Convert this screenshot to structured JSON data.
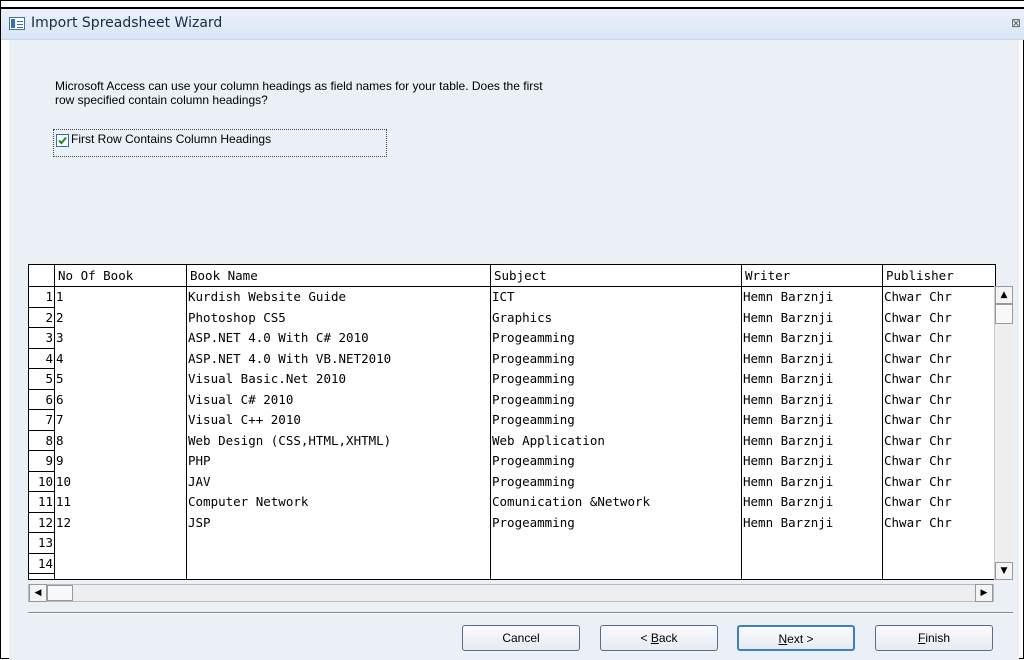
{
  "window": {
    "title": "Import Spreadsheet Wizard",
    "close_glyph": "⊠"
  },
  "instructions": {
    "line1": "Microsoft Access can use your column headings as field names for your table. Does the first",
    "line2": "row specified contain column headings?"
  },
  "checkbox": {
    "label": "First Row Contains Column Headings",
    "checked": true
  },
  "grid": {
    "headers": [
      "No Of Book",
      "Book Name",
      "Subject",
      "Writer",
      "Publisher"
    ],
    "row_numbers": [
      "1",
      "2",
      "3",
      "4",
      "5",
      "6",
      "7",
      "8",
      "9",
      "10",
      "11",
      "12",
      "13",
      "14"
    ],
    "columns": {
      "no": [
        "1",
        "2",
        "3",
        "4",
        "5",
        "6",
        "7",
        "8",
        "9",
        "10",
        "11",
        "12",
        "",
        ""
      ],
      "name": [
        "Kurdish Website Guide",
        "Photoshop CS5",
        "ASP.NET 4.0 With C# 2010",
        "ASP.NET 4.0 With VB.NET2010",
        "Visual Basic.Net 2010",
        "Visual C#  2010",
        "Visual C++ 2010",
        "Web Design (CSS,HTML,XHTML)",
        "PHP",
        "JAV",
        "Computer Network",
        "JSP",
        "",
        ""
      ],
      "subject": [
        "ICT",
        "Graphics",
        "Progeamming",
        "Progeamming",
        "Progeamming",
        "Progeamming",
        "Progeamming",
        "Web Application",
        "Progeamming",
        "Progeamming",
        "Comunication &Network",
        "Progeamming",
        "",
        ""
      ],
      "writer": [
        "Hemn Barznji",
        "Hemn Barznji",
        "Hemn Barznji",
        "Hemn Barznji",
        "Hemn Barznji",
        "Hemn Barznji",
        "Hemn Barznji",
        "Hemn Barznji",
        "Hemn Barznji",
        "Hemn Barznji",
        "Hemn Barznji",
        "Hemn Barznji",
        "",
        ""
      ],
      "publisher": [
        "Chwar Chr",
        "Chwar Chr",
        "Chwar Chr",
        "Chwar Chr",
        "Chwar Chr",
        "Chwar Chr",
        "Chwar Chr",
        "Chwar Chr",
        "Chwar Chr",
        "Chwar Chr",
        "Chwar Chr",
        "Chwar Chr",
        "",
        ""
      ]
    }
  },
  "buttons": {
    "cancel": "Cancel",
    "back": "< Back",
    "next": "Next >",
    "finish": "Finish"
  },
  "icons": {
    "scroll_up": "▲",
    "scroll_down": "▼",
    "scroll_left": "◀",
    "scroll_right": "▶"
  }
}
